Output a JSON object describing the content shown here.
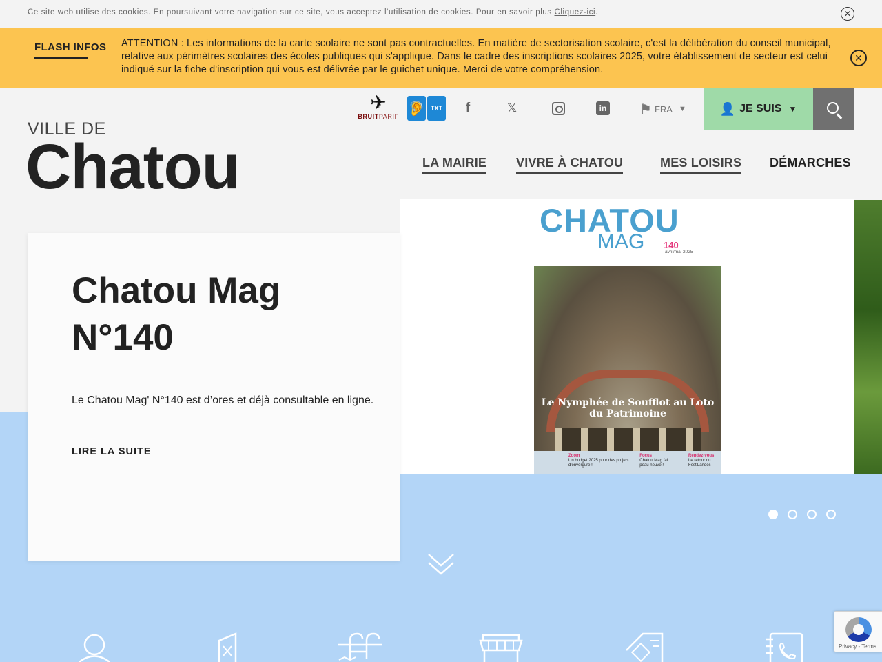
{
  "cookie": {
    "text": "Ce site web utilise des cookies. En poursuivant votre navigation sur ce site, vous acceptez l'utilisation de cookies. Pour en savoir plus",
    "link": "Cliquez-ici",
    "period": ".",
    "close": "✕"
  },
  "flash": {
    "title": "FLASH INFOS",
    "message": "ATTENTION : Les informations de la carte scolaire ne sont pas contractuelles.  En matière de sectorisation scolaire, c'est  la délibération du conseil municipal, relative aux périmètres scolaires des écoles publiques qui s'applique. Dans le cadre des inscriptions scolaires 2025, votre établissement de secteur est celui indiqué sur la fiche d'inscription qui vous est délivrée par le guichet unique. Merci de votre compréhension.",
    "close": "✕"
  },
  "brand": {
    "prefix": "VILLE DE",
    "name": "Chatou"
  },
  "header": {
    "bruitparif_bold": "BRUIT",
    "bruitparif_rest": "PARIF",
    "a11y_txt": "TXT",
    "facebook": "f",
    "x": "𝕏",
    "linkedin": "in",
    "language": "FRA",
    "je_suis": "JE SUIS"
  },
  "nav": {
    "items": [
      "LA MAIRIE",
      "VIVRE À CHATOU",
      "MES LOISIRS",
      "DÉMARCHES"
    ]
  },
  "hero": {
    "title": "Chatou Mag N°140",
    "text": "Le Chatou Mag' N°140 est d’ores et déjà consultable en ligne.",
    "link": "LIRE LA SUITE",
    "slide_count": 4,
    "active_slide": 1
  },
  "magazine": {
    "title": "CHATOU",
    "subtitle": "MAG",
    "number": "140",
    "date": "avril/mai 2025",
    "headline": "Le Nymphée de Soufflot au Loto du Patrimoine",
    "bottom": [
      {
        "label": "Zoom",
        "text": "Un budget 2025 pour des projets d'envergure !"
      },
      {
        "label": "Focus",
        "text": "Chatou Mag fait peau neuve !"
      },
      {
        "label": "Rendez-vous",
        "text": "Le retour du Fest'Landes"
      }
    ]
  },
  "recaptcha": {
    "links": "Privacy - Terms"
  },
  "colors": {
    "flash_bg": "#fcc450",
    "je_suis_bg": "#9fdaa8",
    "search_bg": "#707070",
    "hero_band": "#b3d5f7"
  },
  "icons": [
    "user-icon",
    "menu-card-icon",
    "pool-ladder-icon",
    "shop-icon",
    "newspaper-icon",
    "phone-book-icon"
  ]
}
